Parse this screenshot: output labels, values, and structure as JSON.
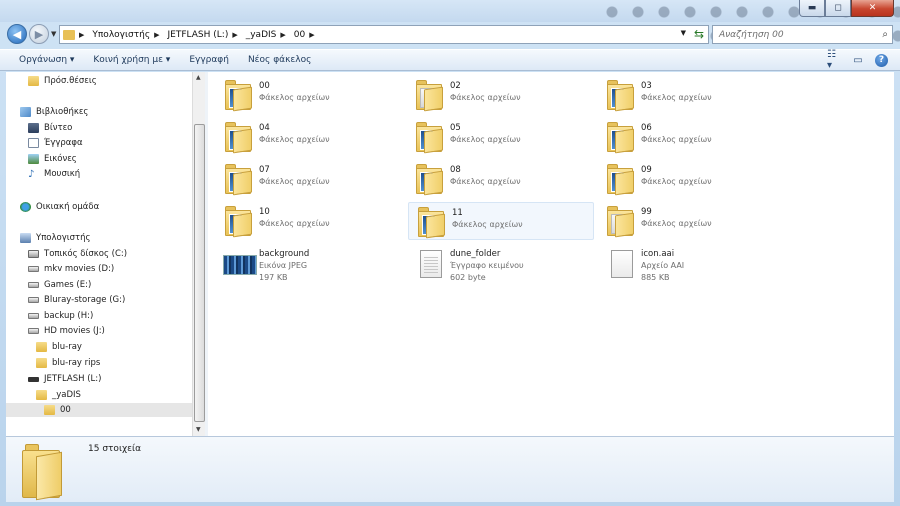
{
  "window": {
    "minimize": "▬",
    "maximize": "◻",
    "close": "✕"
  },
  "address": {
    "crumbs": [
      "Υπολογιστής",
      "JETFLASH (L:)",
      "_yaDIS",
      "00"
    ],
    "search_placeholder": "Αναζήτηση 00"
  },
  "toolbar": {
    "organize": "Οργάνωση ▾",
    "share": "Κοινή χρήση με ▾",
    "burn": "Εγγραφή",
    "new_folder": "Νέος φάκελος"
  },
  "nav": {
    "recent": "Πρόσ.θέσεις",
    "libraries": "Βιβλιοθήκες",
    "video": "Βίντεο",
    "documents": "Έγγραφα",
    "pictures": "Εικόνες",
    "music": "Μουσική",
    "homegroup": "Οικιακή ομάδα",
    "computer": "Υπολογιστής",
    "drive_c": "Τοπικός δίσκος (C:)",
    "drive_d": "mkv movies (D:)",
    "drive_e": "Games (E:)",
    "drive_g": "Bluray-storage  (G:)",
    "drive_h": "backup (H:)",
    "drive_j": "HD movies  (J:)",
    "bluray": "blu-ray",
    "bluray_rips": "blu-ray rips",
    "drive_l": "JETFLASH (L:)",
    "yadis": "_yaDIS",
    "folder_00": "00"
  },
  "items": [
    {
      "name": "00",
      "type": "Φάκελος αρχείων"
    },
    {
      "name": "02",
      "type": "Φάκελος αρχείων"
    },
    {
      "name": "03",
      "type": "Φάκελος αρχείων"
    },
    {
      "name": "04",
      "type": "Φάκελος αρχείων"
    },
    {
      "name": "05",
      "type": "Φάκελος αρχείων"
    },
    {
      "name": "06",
      "type": "Φάκελος αρχείων"
    },
    {
      "name": "07",
      "type": "Φάκελος αρχείων"
    },
    {
      "name": "08",
      "type": "Φάκελος αρχείων"
    },
    {
      "name": "09",
      "type": "Φάκελος αρχείων"
    },
    {
      "name": "10",
      "type": "Φάκελος αρχείων"
    },
    {
      "name": "11",
      "type": "Φάκελος αρχείων"
    },
    {
      "name": "99",
      "type": "Φάκελος αρχείων"
    },
    {
      "name": "background",
      "type": "Εικόνα JPEG",
      "size": "197 KB"
    },
    {
      "name": "dune_folder",
      "type": "Έγγραφο κειμένου",
      "size": "602 byte"
    },
    {
      "name": "icon.aai",
      "type": "Αρχείο AAI",
      "size": "885 KB"
    }
  ],
  "status": {
    "count": "15 στοιχεία"
  },
  "colors": {
    "accent": "#1e395b",
    "selection": "#e6e6e6",
    "hover": "#f2f7fd"
  }
}
